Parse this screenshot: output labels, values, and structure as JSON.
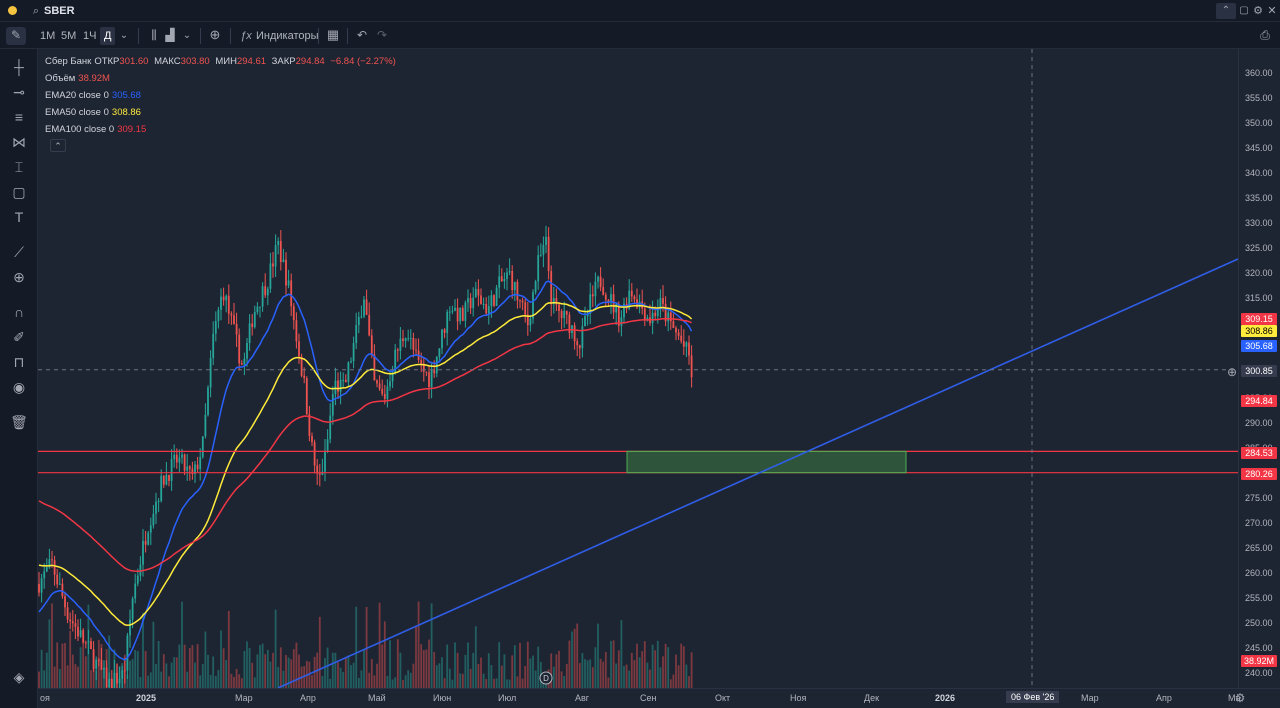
{
  "topbar": {
    "symbol": "SBER"
  },
  "toolbar": {
    "timeframes": [
      "1M",
      "5M",
      "1Ч",
      "Д"
    ],
    "indicators_label": "Индикаторы"
  },
  "legend": {
    "name": "Сбер Банк",
    "open_label": "ОТКР",
    "open": "301.60",
    "high_label": "МАКС",
    "high": "303.80",
    "low_label": "МИН",
    "low": "294.61",
    "close_label": "ЗАКР",
    "close": "294.84",
    "change": "−6.84 (−2.27%)",
    "volume_label": "Объём",
    "volume": "38.92M",
    "ema20_label": "EMA20 close 0",
    "ema20": "305.68",
    "ema50_label": "EMA50 close 0",
    "ema50": "308.86",
    "ema100_label": "EMA100 close 0",
    "ema100": "309.15"
  },
  "price_axis": {
    "ticks": [
      "360.00",
      "355.00",
      "350.00",
      "345.00",
      "340.00",
      "335.00",
      "330.00",
      "325.00",
      "320.00",
      "315.00",
      "310.00",
      "305.00",
      "300.00",
      "295.00",
      "290.00",
      "285.00",
      "280.00",
      "275.00",
      "270.00",
      "265.00",
      "260.00",
      "255.00",
      "250.00",
      "245.00",
      "240.00"
    ],
    "tags": {
      "ema100": "309.15",
      "ema50": "308.86",
      "ema20": "305.68",
      "crosshair": "300.85",
      "close": "294.84",
      "level1": "284.53",
      "level2": "280.26",
      "volume": "38.92M"
    }
  },
  "time_axis": {
    "labels": [
      "оя",
      "2025",
      "Мар",
      "Апр",
      "Май",
      "Июн",
      "Июл",
      "Авг",
      "Сен",
      "Окт",
      "Ноя",
      "Дек",
      "2026",
      "06 Фев '26",
      "Мар",
      "Апр",
      "Ма"
    ]
  },
  "colors": {
    "background": "#1e2532",
    "up": "#26a69a",
    "down": "#ef5350",
    "ema20": "#2962ff",
    "ema50": "#ffeb3b",
    "ema100": "#f23645",
    "trendline": "#2f5ee8",
    "level": "#f23645",
    "zone": "#4caf50"
  },
  "chart_data": {
    "type": "candlestick",
    "series": [
      {
        "name": "EMA20",
        "values": []
      },
      {
        "name": "EMA50",
        "values": []
      },
      {
        "name": "EMA100",
        "values": []
      }
    ],
    "ylim": [
      240,
      360
    ],
    "last_close": 294.84,
    "horizontal_levels": [
      284.53,
      280.26
    ]
  }
}
